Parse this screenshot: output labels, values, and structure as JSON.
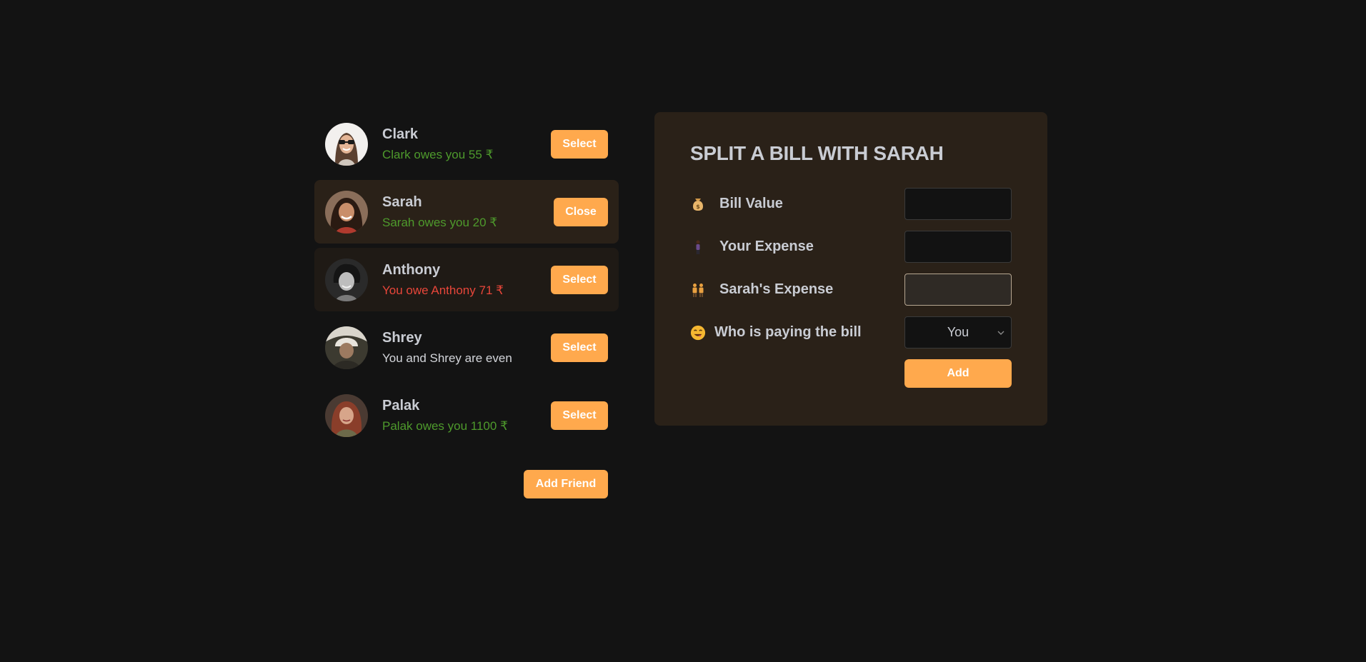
{
  "friends": [
    {
      "name": "Clark",
      "status": "Clark owes you 55 ₹",
      "button_label": "Select"
    },
    {
      "name": "Sarah",
      "status": "Sarah owes you 20 ₹",
      "button_label": "Close"
    },
    {
      "name": "Anthony",
      "status": "You owe Anthony 71 ₹",
      "button_label": "Select"
    },
    {
      "name": "Shrey",
      "status": "You and Shrey are even",
      "button_label": "Select"
    },
    {
      "name": "Palak",
      "status": "Palak owes you 1100 ₹",
      "button_label": "Select"
    }
  ],
  "add_friend_label": "Add Friend",
  "split_form": {
    "title": "SPLIT A BILL WITH SARAH",
    "bill_value_label": "Bill Value",
    "bill_value": "",
    "your_expense_label": "Your Expense",
    "your_expense": "",
    "friend_expense_label": "Sarah's Expense",
    "friend_expense": "",
    "payer_label": "Who is paying the bill",
    "payer_value": "You",
    "add_label": "Add"
  },
  "colors": {
    "accent": "#ffa94d",
    "owes_you": "#4e9a2c",
    "you_owe": "#e8463a",
    "panel": "#2a2118",
    "background": "#131313"
  },
  "icons": {
    "bill_value": "money-bag-icon",
    "your_expense": "person-standing-icon",
    "friend_expense": "two-people-icon",
    "payer": "yum-face-icon"
  }
}
